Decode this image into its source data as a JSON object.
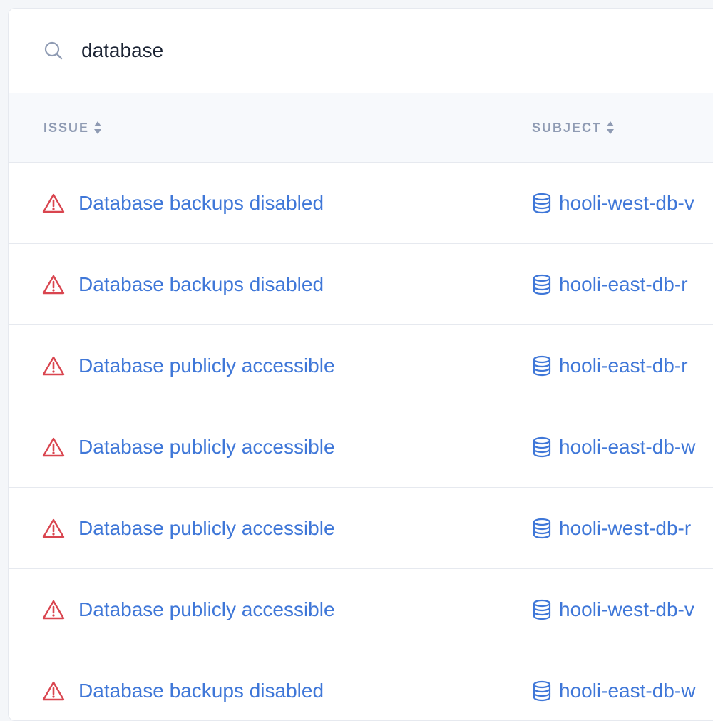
{
  "search": {
    "value": "database",
    "icon": "search-icon"
  },
  "table": {
    "columns": [
      {
        "label": "ISSUE",
        "sort_icon": "sort-icon"
      },
      {
        "label": "SUBJECT",
        "sort_icon": "sort-icon"
      }
    ],
    "rows": [
      {
        "issue": "Database backups disabled",
        "subject": "hooli-west-db-v"
      },
      {
        "issue": "Database backups disabled",
        "subject": "hooli-east-db-r"
      },
      {
        "issue": "Database publicly accessible",
        "subject": "hooli-east-db-r"
      },
      {
        "issue": "Database publicly accessible",
        "subject": "hooli-east-db-w"
      },
      {
        "issue": "Database publicly accessible",
        "subject": "hooli-west-db-r"
      },
      {
        "issue": "Database publicly accessible",
        "subject": "hooli-west-db-v"
      },
      {
        "issue": "Database backups disabled",
        "subject": "hooli-east-db-w"
      }
    ]
  },
  "colors": {
    "link": "#3f77d8",
    "warning": "#d9454f",
    "header_text": "#8f9bb3",
    "search_text": "#1c2434"
  }
}
